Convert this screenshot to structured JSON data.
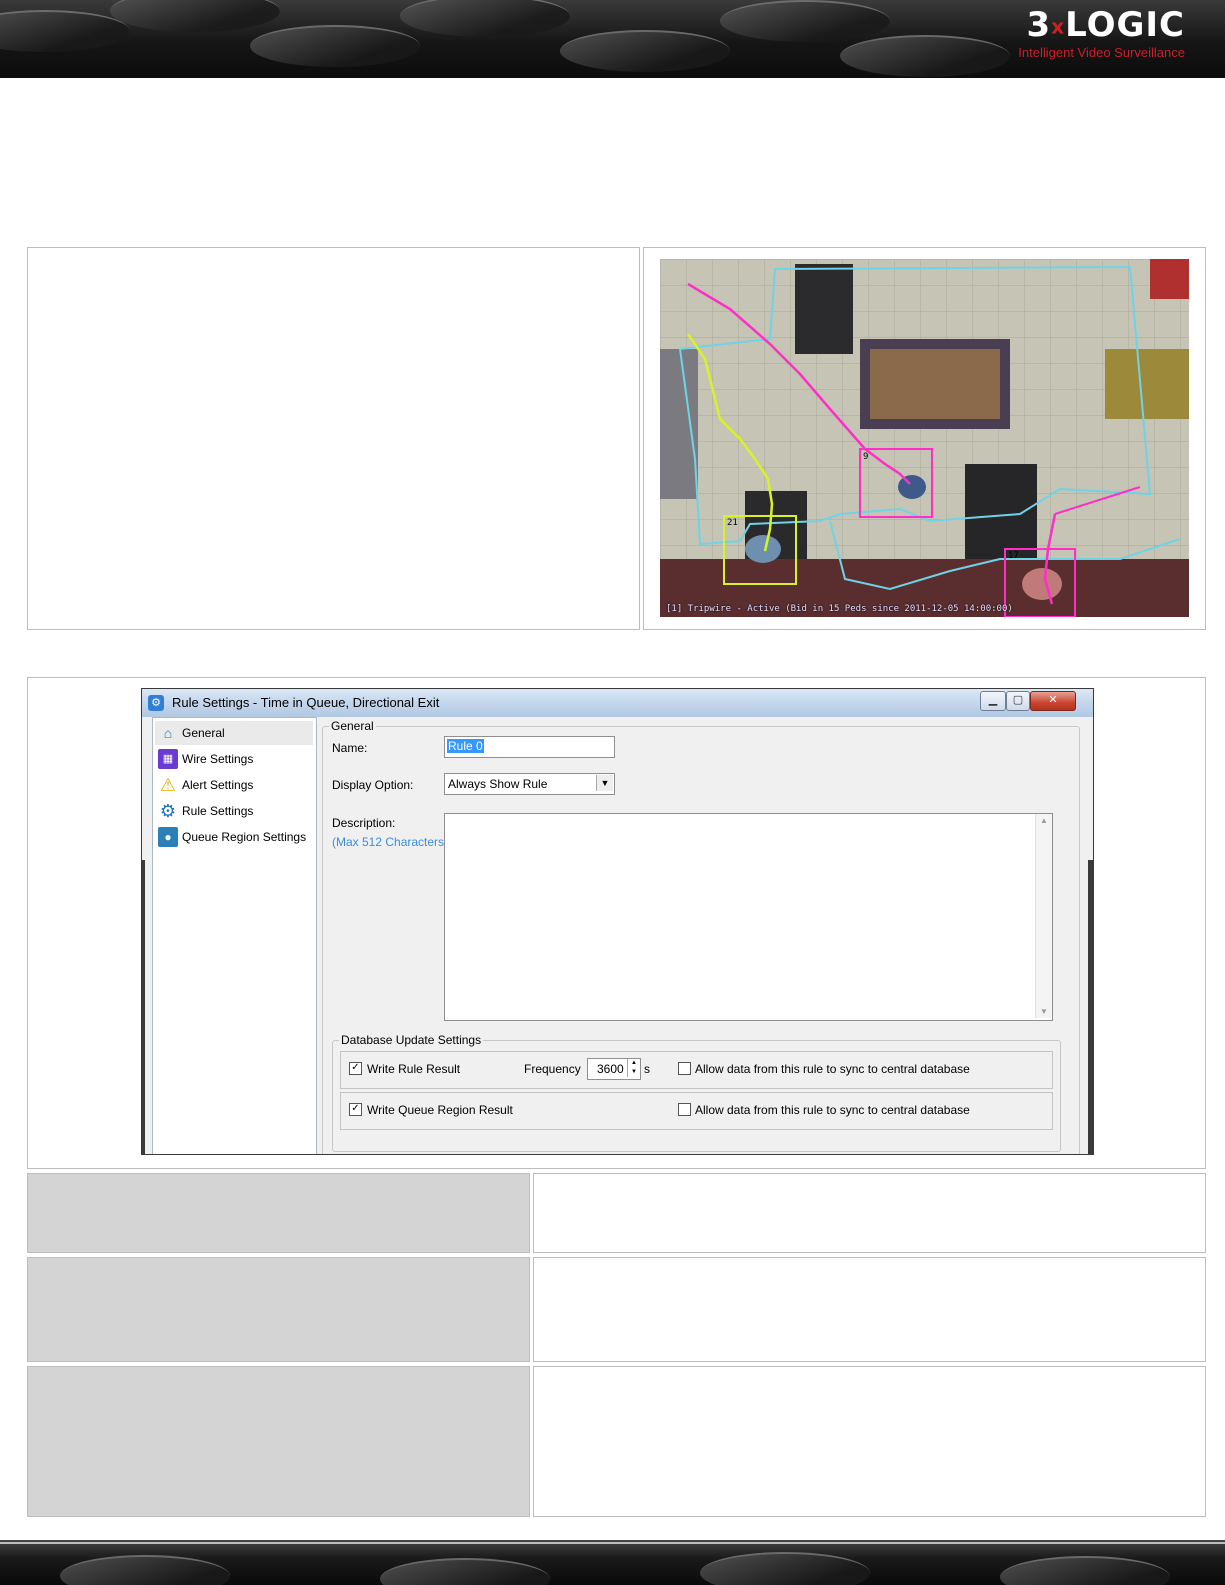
{
  "header": {
    "logo_text_prefix": "3",
    "logo_x": "x",
    "logo_text_suffix": "LOGIC",
    "logo_tagline": "Intelligent Video Surveillance"
  },
  "camera_overlay": {
    "caption": "[1] Tripwire - Active (Bid in 15 Peds since 2011-12-05 14:00:00)",
    "track_ids": [
      "9",
      "17",
      "21"
    ]
  },
  "dialog": {
    "title": "Rule Settings - Time in Queue, Directional Exit",
    "nav": [
      {
        "label": "General",
        "icon": "home-icon"
      },
      {
        "label": "Wire Settings",
        "icon": "film-icon"
      },
      {
        "label": "Alert Settings",
        "icon": "warning-icon"
      },
      {
        "label": "Rule Settings",
        "icon": "gear-icon"
      },
      {
        "label": "Queue Region Settings",
        "icon": "map-pin-icon"
      }
    ],
    "general_group_title": "General",
    "name_label": "Name:",
    "name_value": "Rule 0",
    "display_option_label": "Display Option:",
    "display_option_value": "Always Show Rule",
    "description_label": "Description:",
    "description_hint": "(Max 512 Characters)",
    "db_group_title": "Database Update Settings",
    "write_rule_result_label": "Write Rule Result",
    "frequency_label": "Frequency",
    "frequency_value": "3600",
    "frequency_unit": "s",
    "sync_label_1": "Allow data from this rule to sync to central database",
    "write_queue_label": "Write Queue Region Result",
    "sync_label_2": "Allow data from this rule to sync to central database"
  },
  "colors": {
    "accent_red": "#c8202a",
    "overlay_cyan": "#6fd3e6",
    "overlay_magenta": "#ff2ec8",
    "overlay_yellow": "#d8f22a"
  }
}
